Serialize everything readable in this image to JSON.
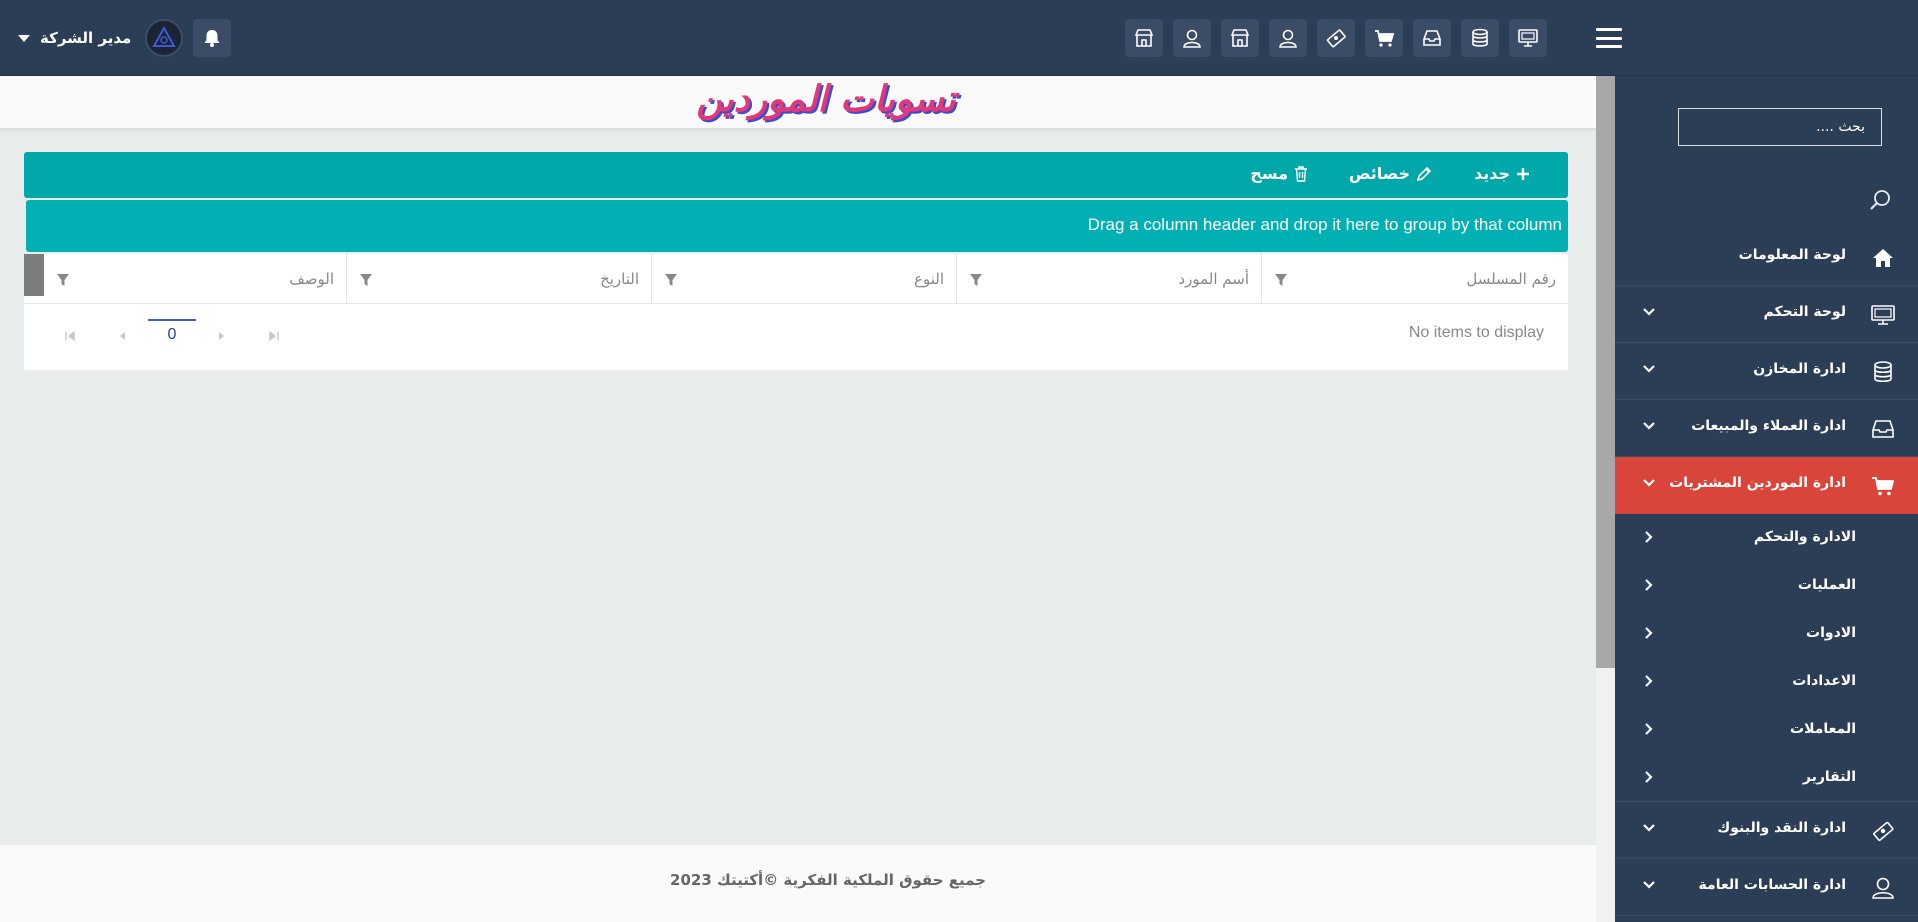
{
  "header": {
    "user_name": "مدير الشركة",
    "quick_icons": [
      "desktop-icon",
      "database-icon",
      "inbox-icon",
      "cart-icon",
      "money-icon",
      "user-icon",
      "store-icon",
      "user-icon",
      "store-icon"
    ]
  },
  "sidebar": {
    "search_placeholder": "بحث ....",
    "items": [
      {
        "label": "لوحة المعلومات",
        "icon": "home-icon"
      },
      {
        "label": "لوحة التحكم",
        "icon": "desktop-icon"
      },
      {
        "label": "ادارة المخازن",
        "icon": "database-icon"
      },
      {
        "label": "ادارة العملاء والمبيعات",
        "icon": "inbox-icon"
      },
      {
        "label": "ادارة الموردين المشتريات",
        "icon": "cart-icon",
        "active": true
      },
      {
        "label": "ادارة النقد والبنوك",
        "icon": "money-icon"
      },
      {
        "label": "ادارة الحسابات العامة",
        "icon": "user-icon"
      }
    ],
    "sub_items": [
      {
        "label": "الادارة والتحكم"
      },
      {
        "label": "العمليات"
      },
      {
        "label": "الادوات"
      },
      {
        "label": "الاعدادات"
      },
      {
        "label": "المعاملات"
      },
      {
        "label": "التقارير"
      }
    ],
    "active_color": "#d9443b"
  },
  "page": {
    "title": "تسويات الموردين"
  },
  "toolbar": {
    "new_label": "جديد",
    "properties_label": "خصائص",
    "delete_label": "مسح"
  },
  "grid": {
    "group_panel_text": "Drag a column header and drop it here to group by that column",
    "columns": [
      "رقم المسلسل",
      "أسم المورد",
      "النوع",
      "التاريخ",
      "الوصف"
    ],
    "empty_message": "No items to display",
    "page_number": "0"
  },
  "footer": {
    "text": "جميع حقوق الملكية الفكرية ©أكتيتك 2023"
  },
  "colors": {
    "topbar": "#2c3e55",
    "accent_teal": "#00a8aa",
    "title_pink": "#e0387a",
    "title_shadow": "#3a4dcf"
  }
}
